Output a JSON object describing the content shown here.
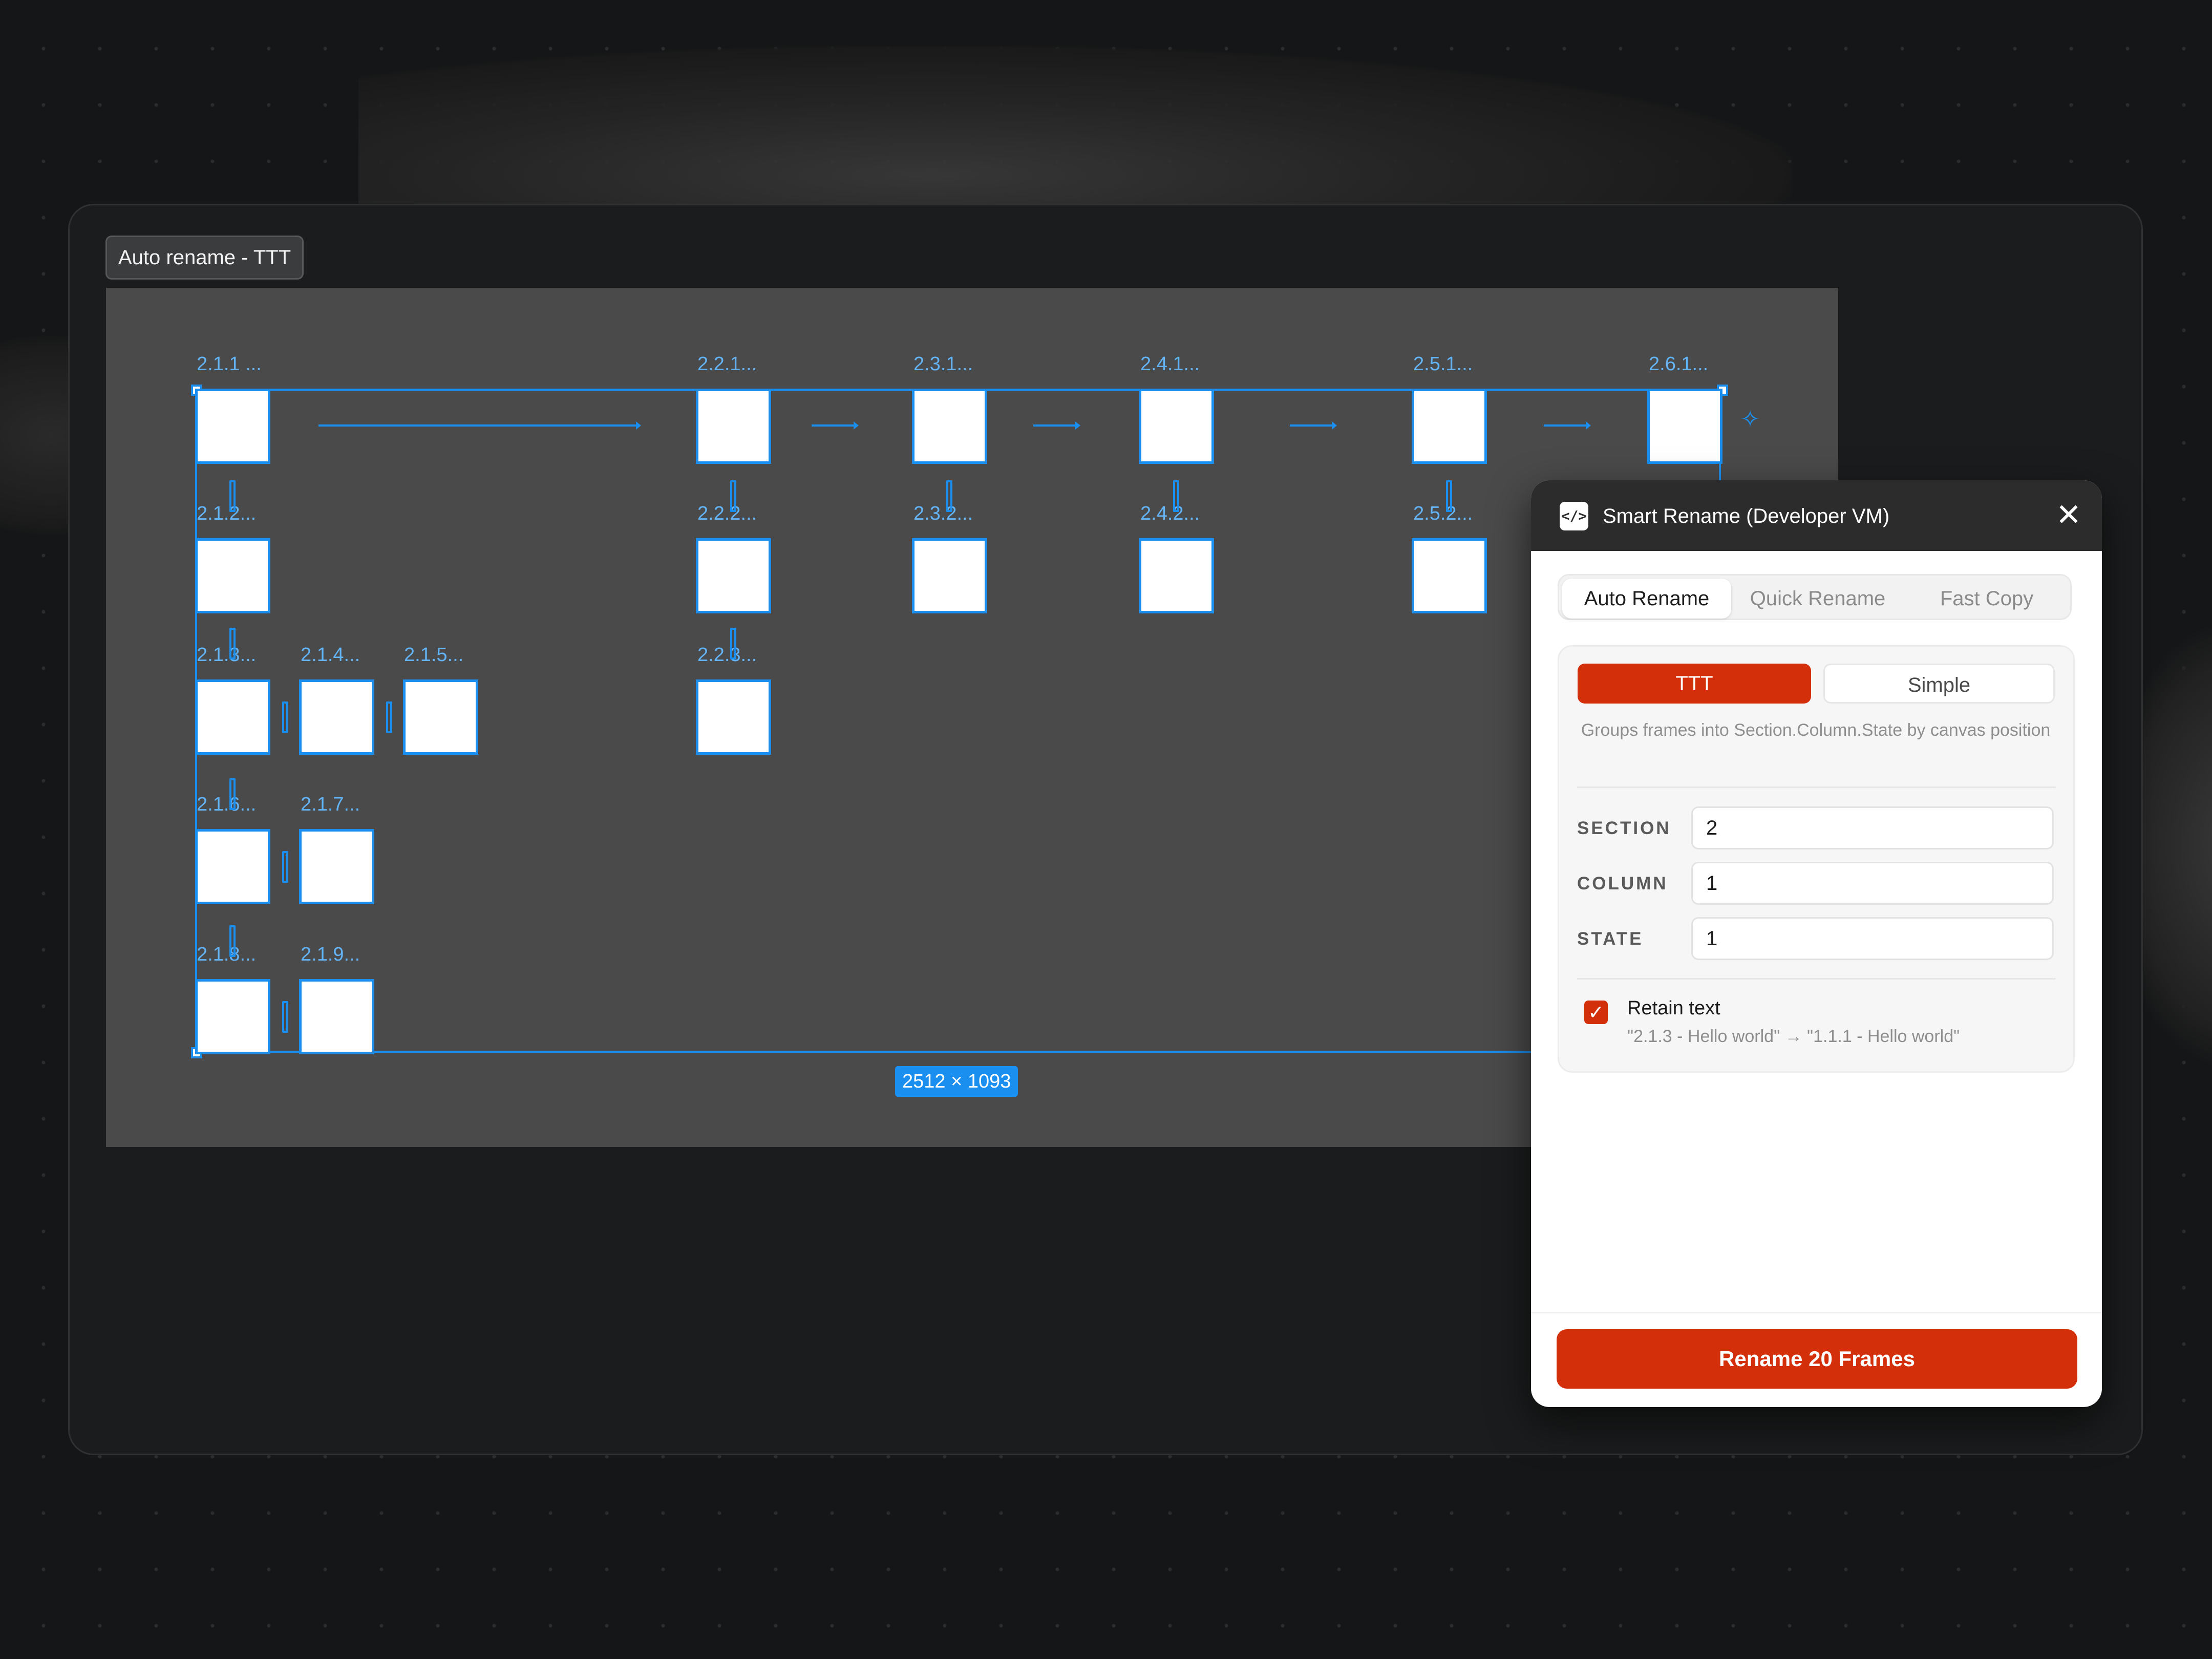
{
  "frame_tag": "Auto rename - TTT",
  "canvas": {
    "dimension_badge": "2512 × 1093",
    "frames": [
      {
        "label": "2.1.1 ..."
      },
      {
        "label": "2.1.2..."
      },
      {
        "label": "2.1.3..."
      },
      {
        "label": "2.1.4..."
      },
      {
        "label": "2.1.5..."
      },
      {
        "label": "2.1.6..."
      },
      {
        "label": "2.1.7..."
      },
      {
        "label": "2.1.8..."
      },
      {
        "label": "2.1.9..."
      },
      {
        "label": "2.2.1..."
      },
      {
        "label": "2.2.2..."
      },
      {
        "label": "2.2.3..."
      },
      {
        "label": "2.3.1..."
      },
      {
        "label": "2.3.2..."
      },
      {
        "label": "2.4.1..."
      },
      {
        "label": "2.4.2..."
      },
      {
        "label": "2.5.1..."
      },
      {
        "label": "2.5.2..."
      },
      {
        "label": "2.6.1..."
      }
    ]
  },
  "panel": {
    "icon": "code-icon",
    "icon_glyph": "</>",
    "title": "Smart Rename (Developer VM)",
    "close_glyph": "✕",
    "tabs": [
      "Auto Rename",
      "Quick Rename",
      "Fast Copy"
    ],
    "active_tab": "Auto Rename",
    "modes": [
      "TTT",
      "Simple"
    ],
    "active_mode": "TTT",
    "description": "Groups frames into Section.Column.State by canvas position",
    "fields": [
      {
        "label": "SECTION",
        "value": "2"
      },
      {
        "label": "COLUMN",
        "value": "1"
      },
      {
        "label": "STATE",
        "value": "1"
      }
    ],
    "retain": {
      "checked": true,
      "check_glyph": "✓",
      "title": "Retain text",
      "example": "\"2.1.3 - Hello world\" → \"1.1.1 - Hello world\""
    },
    "action_button": "Rename 20 Frames"
  },
  "colors": {
    "accent": "#d32f0a",
    "selection": "#1a8ff0",
    "canvas": "#4a4a4b",
    "background": "#151617"
  }
}
